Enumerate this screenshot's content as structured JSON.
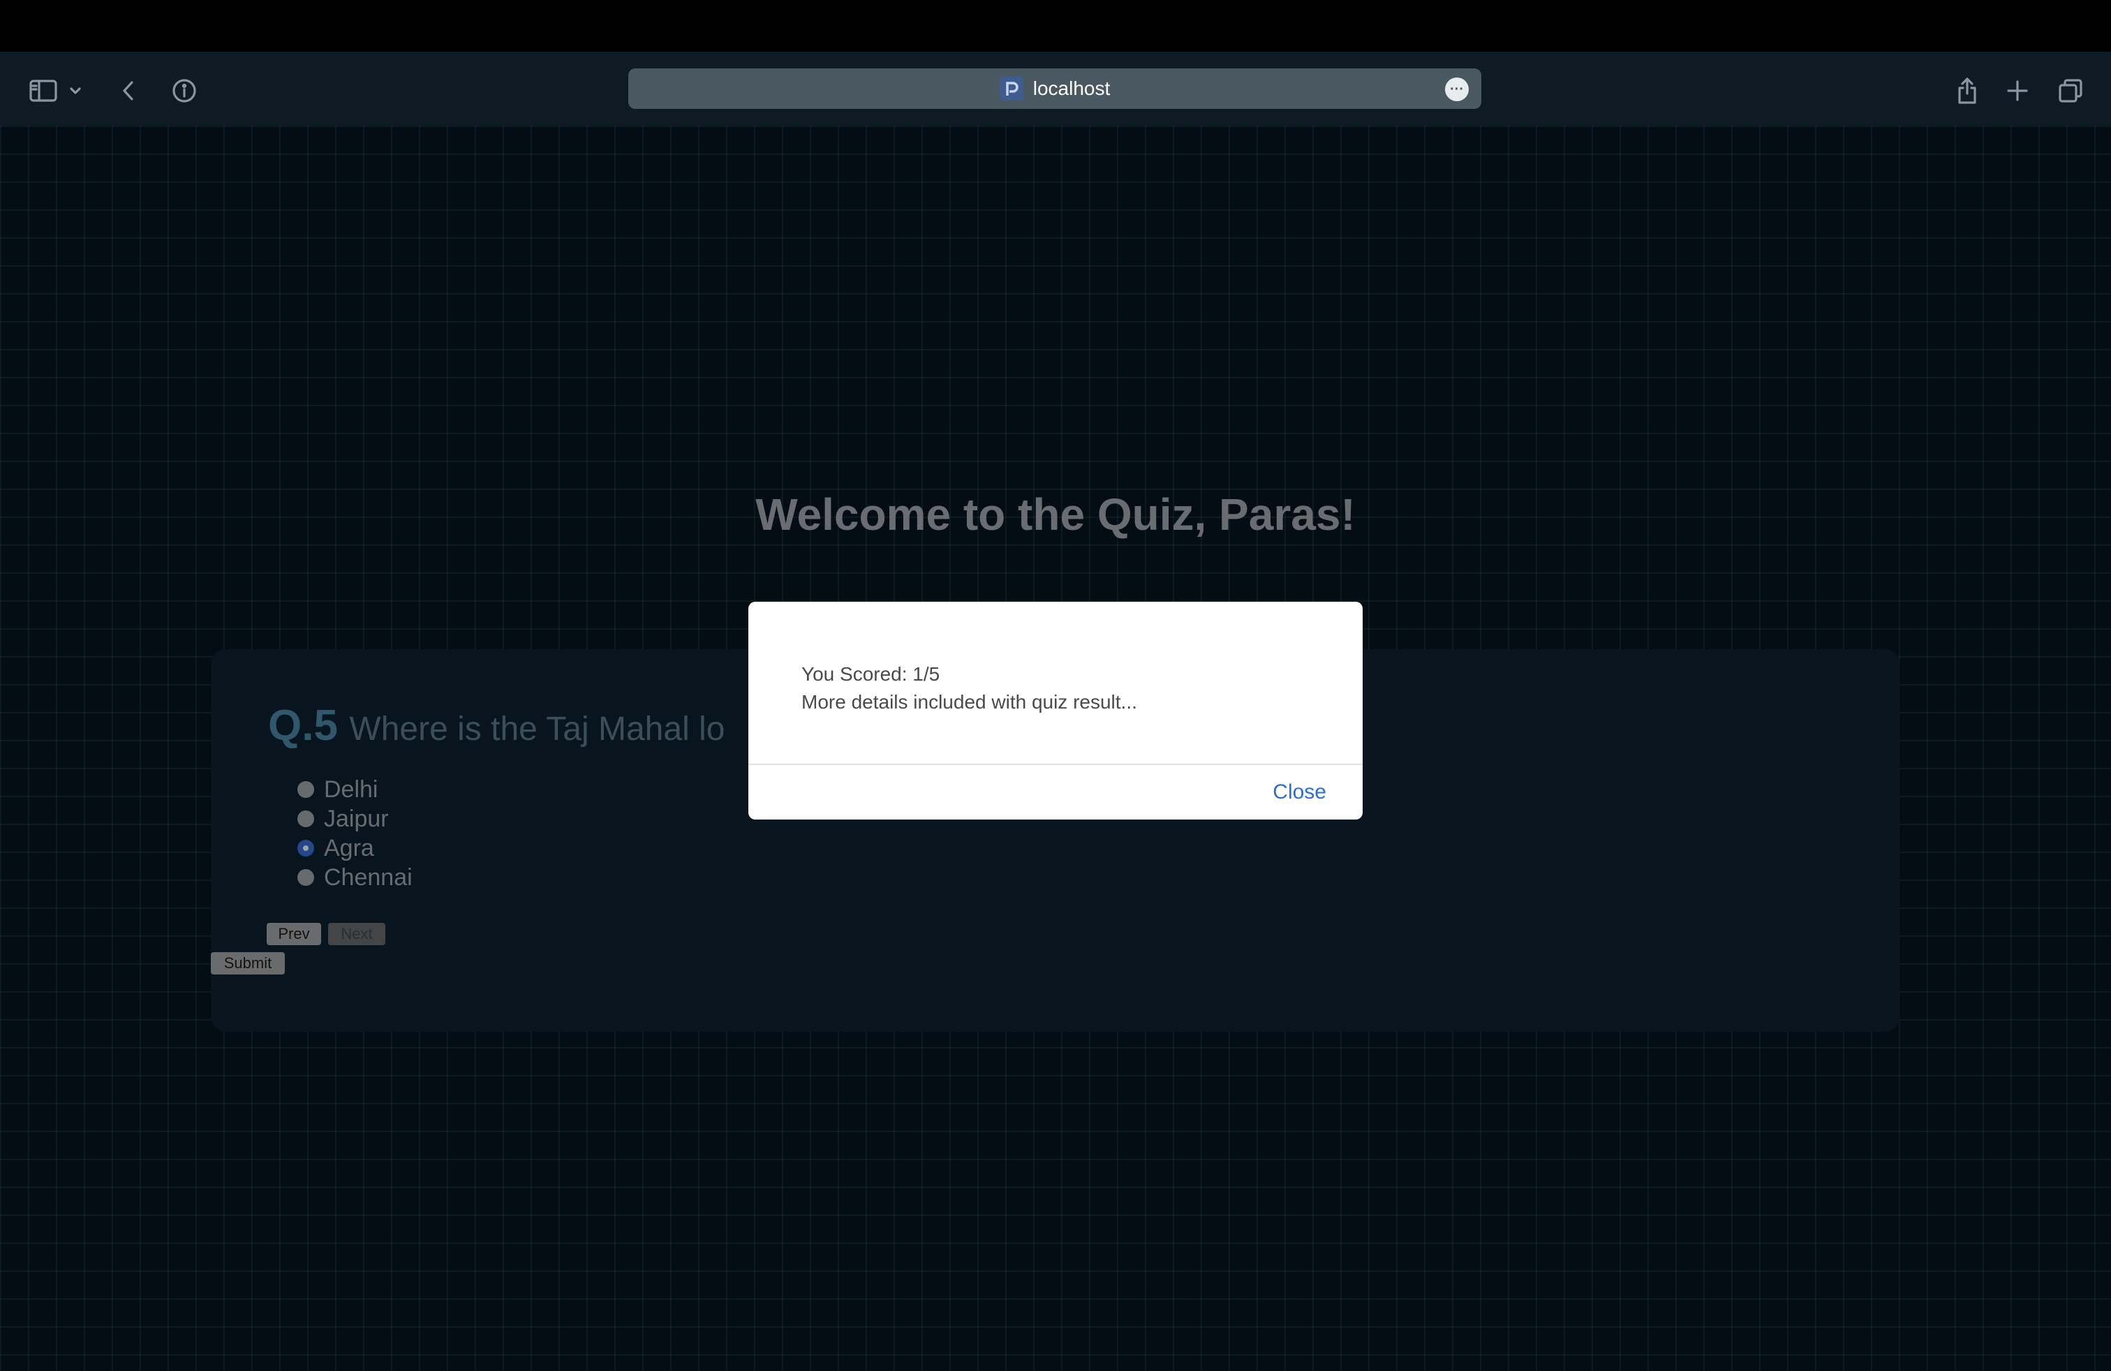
{
  "browser": {
    "url": "localhost",
    "icons": [
      "sidebar-icon",
      "chevron-down-icon",
      "back-icon",
      "info-icon",
      "more-icon",
      "share-icon",
      "plus-icon",
      "tabs-icon"
    ]
  },
  "page": {
    "title": "Welcome to the Quiz, Paras!"
  },
  "quiz": {
    "question_number": "Q.5",
    "question_text": "Where is the Taj Mahal lo",
    "options": [
      {
        "label": "Delhi",
        "selected": false
      },
      {
        "label": "Jaipur",
        "selected": false
      },
      {
        "label": "Agra",
        "selected": true
      },
      {
        "label": "Chennai",
        "selected": false
      }
    ],
    "prev_label": "Prev",
    "next_label": "Next",
    "submit_label": "Submit"
  },
  "modal": {
    "score_text": "You Scored: 1/5",
    "details_text": "More details included with quiz result...",
    "close_label": "Close"
  },
  "colors": {
    "accent": "#3f7690",
    "link": "#2a6fd6",
    "selected_radio": "#2f5fb8"
  }
}
